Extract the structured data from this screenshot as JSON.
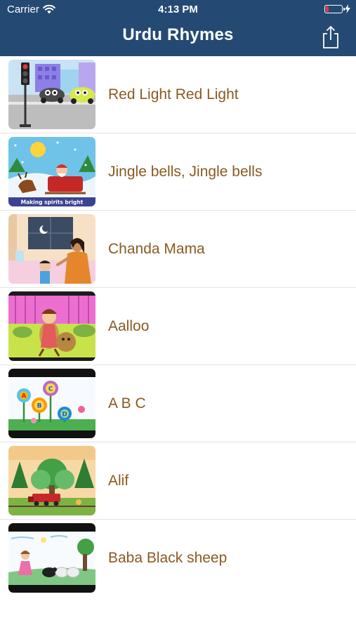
{
  "status_bar": {
    "carrier": "Carrier",
    "time": "4:13 PM",
    "battery_color": "#e23b3b"
  },
  "header": {
    "title": "Urdu Rhymes",
    "background_color": "#244a73",
    "share_icon": "share-icon"
  },
  "rhymes": [
    {
      "title": "Red Light Red Light",
      "thumbnail": "traffic-light-cars-scene"
    },
    {
      "title": "Jingle bells, Jingle bells",
      "thumbnail": "santa-sleigh-snow-scene",
      "thumbnail_caption": "Making spirits bright"
    },
    {
      "title": "Chanda Mama",
      "thumbnail": "mother-child-moon-window-scene"
    },
    {
      "title": "Aalloo",
      "thumbnail": "potato-characters-garden-scene"
    },
    {
      "title": "A B C",
      "thumbnail": "abc-flowers-scene",
      "thumbnail_letters": [
        "A",
        "B",
        "C",
        "D"
      ]
    },
    {
      "title": "Alif",
      "thumbnail": "forest-train-scene"
    },
    {
      "title": "Baba Black sheep",
      "thumbnail": "girl-sheep-meadow-scene"
    }
  ],
  "colors": {
    "title_text": "#8a5a22",
    "separator": "#e3e3e3"
  }
}
